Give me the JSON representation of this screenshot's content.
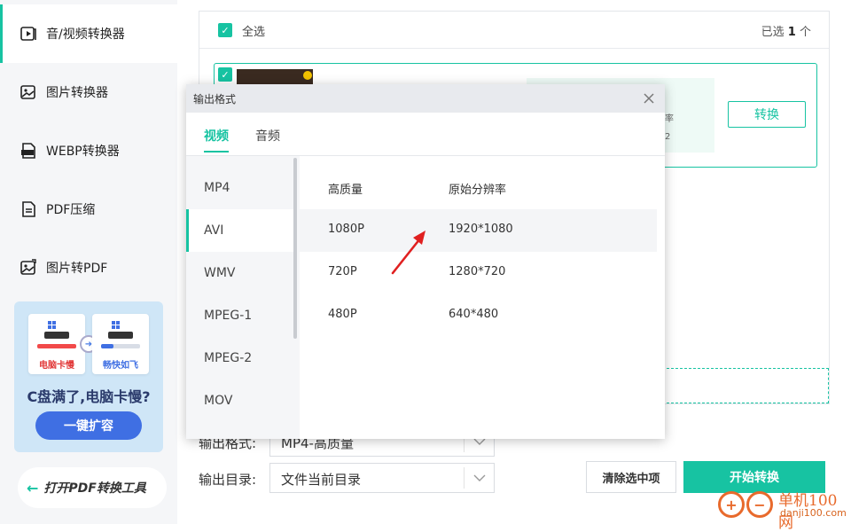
{
  "sidebar": {
    "items": [
      {
        "label": "音/视频转换器",
        "icon": "play-video-icon",
        "active": true
      },
      {
        "label": "图片转换器",
        "icon": "image-convert-icon",
        "active": false
      },
      {
        "label": "WEBP转换器",
        "icon": "webp-file-icon",
        "active": false
      },
      {
        "label": "PDF压缩",
        "icon": "pdf-file-icon",
        "active": false
      },
      {
        "label": "图片转PDF",
        "icon": "image-to-pdf-icon",
        "active": false
      }
    ],
    "promo": {
      "card_left_label": "电脑卡慢",
      "card_right_label": "畅快如飞",
      "title": "C盘满了,电脑卡慢?",
      "button": "一键扩容"
    },
    "pdf_tool": "打开PDF转换工具"
  },
  "list": {
    "select_all": "全选",
    "selected_prefix": "已选",
    "selected_count": "1",
    "selected_suffix": "个",
    "info_line1": "率",
    "info_line2": "2",
    "convert_button": "转换"
  },
  "form": {
    "output_format_label": "输出格式:",
    "output_format_value": "MP4-高质量",
    "output_dir_label": "输出目录:",
    "output_dir_value": "文件当前目录"
  },
  "actions": {
    "clear_selected": "清除选中项",
    "start_convert": "开始转换"
  },
  "modal": {
    "title": "输出格式",
    "tabs": [
      "视频",
      "音频"
    ],
    "active_tab": "视频",
    "formats": [
      "MP4",
      "AVI",
      "WMV",
      "MPEG-1",
      "MPEG-2",
      "MOV"
    ],
    "selected_format": "AVI",
    "columns": {
      "quality": "高质量",
      "resolution": "原始分辨率"
    },
    "resolutions": [
      {
        "quality": "1080P",
        "resolution": "1920*1080"
      },
      {
        "quality": "720P",
        "resolution": "1280*720"
      },
      {
        "quality": "480P",
        "resolution": "640*480"
      }
    ]
  },
  "watermark": {
    "title": "单机100网",
    "url": "danji100.com"
  },
  "colors": {
    "accent": "#17c3a2",
    "promo_blue": "#3f6fe3",
    "arrow_red": "#e02020"
  }
}
